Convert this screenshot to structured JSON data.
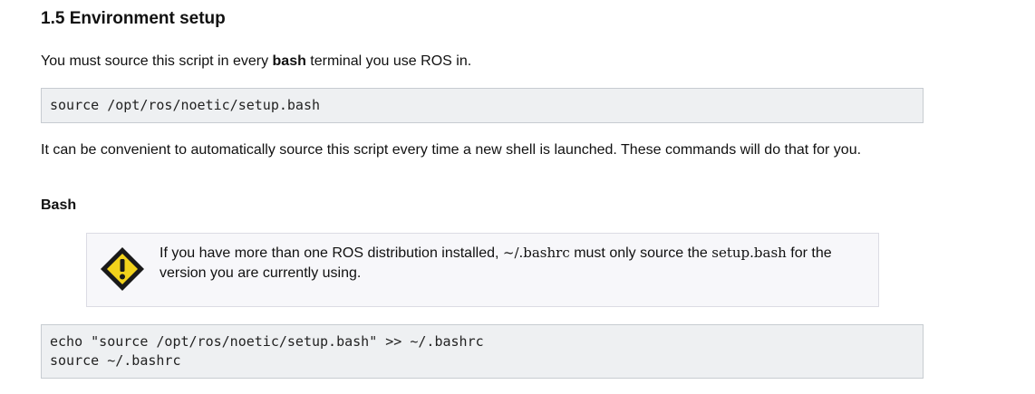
{
  "section": {
    "title": "1.5 Environment setup",
    "intro_before": "You must source this script in every ",
    "intro_bold": "bash",
    "intro_after": " terminal you use ROS in.",
    "code1": "source /opt/ros/noetic/setup.bash",
    "paragraph": "It can be convenient to automatically source this script every time a new shell is launched. These commands will do that for you.",
    "subheading": "Bash",
    "warning": {
      "icon": "warning-icon",
      "text_before": "If you have more than one ROS distribution installed, ",
      "code_a": "~/.bashrc",
      "text_middle": " must only source the ",
      "code_b": "setup.bash",
      "text_after": " for the version you are currently using."
    },
    "code2_lines": [
      "echo \"source /opt/ros/noetic/setup.bash\" >> ~/.bashrc",
      "source ~/.bashrc"
    ]
  },
  "colors": {
    "code_bg": "#eef0f2",
    "code_border": "#c7ccd1",
    "warning_bg": "#f7f7fa",
    "warning_icon_fill": "#f2d21b",
    "warning_icon_border": "#1a1a1a"
  }
}
